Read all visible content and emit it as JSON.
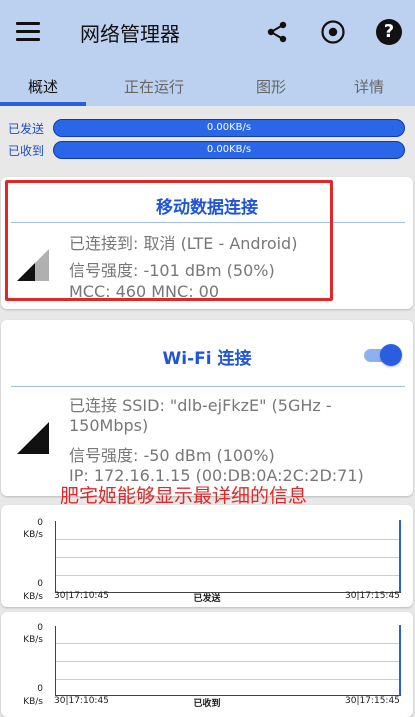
{
  "appbar": {
    "title": "网络管理器",
    "icons": [
      "menu-icon",
      "share-icon",
      "target-icon",
      "help-icon"
    ],
    "help_glyph": "?"
  },
  "tabs": [
    {
      "label": "概述",
      "active": true
    },
    {
      "label": "正在运行",
      "active": false
    },
    {
      "label": "图形",
      "active": false
    },
    {
      "label": "详情",
      "active": false
    }
  ],
  "traffic": {
    "sent_label": "已发送",
    "sent_value": "0.00KB/s",
    "received_label": "已收到",
    "received_value": "0.00KB/s"
  },
  "mobile": {
    "title": "移动数据连接",
    "connected_to": "已连接到: 取消 (LTE - Android)",
    "signal": "信号强度: -101 dBm (50%)",
    "mcc": "MCC: 460 MNC: 00"
  },
  "wifi": {
    "title": "Wi-Fi 连接",
    "enabled": true,
    "ssid_line1": "已连接 SSID: \"dlb-ejFkzE\" (5GHz -",
    "ssid_line2": "150Mbps)",
    "signal": "信号强度: -50 dBm (100%)",
    "ip": "IP: 172.16.1.15 (00:DB:0A:2C:2D:71)"
  },
  "watermark": "肥宅姬能够显示最详细的信息",
  "graphs": {
    "sent": {
      "y_top": "0",
      "y_bottom": "0",
      "unit": "KB/s",
      "start_time": "30|17:10:45",
      "end_time": "30|17:15:45",
      "label": "已发送"
    },
    "received": {
      "y_top": "0",
      "y_bottom": "0",
      "unit": "KB/s",
      "start_time": "30|17:10:45",
      "end_time": "30|17:15:45",
      "label": "已收到"
    }
  },
  "colors": {
    "appbar": "#bcd0f0",
    "accent": "#2a5ee0",
    "annotation": "#e02828"
  }
}
